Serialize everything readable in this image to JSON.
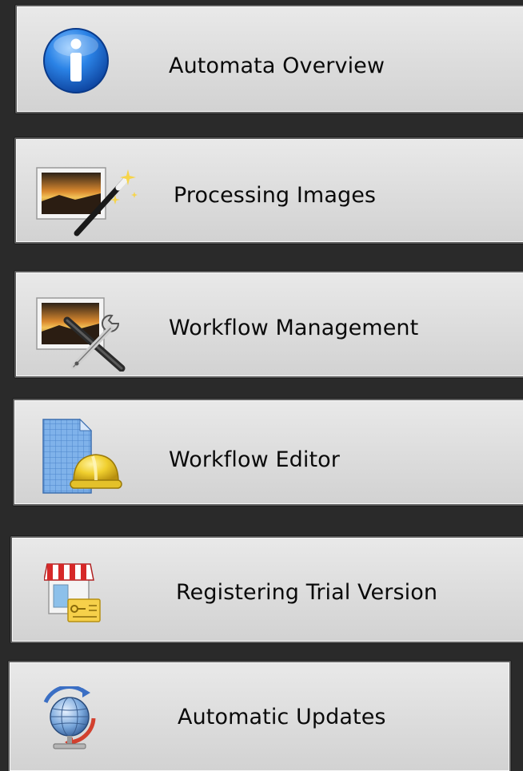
{
  "menu": {
    "items": [
      {
        "label": "Automata Overview",
        "icon": "info-icon"
      },
      {
        "label": "Processing Images",
        "icon": "image-wand-icon"
      },
      {
        "label": "Workflow Management",
        "icon": "image-tools-icon"
      },
      {
        "label": "Workflow Editor",
        "icon": "blueprint-hardhat-icon"
      },
      {
        "label": "Registering Trial Version",
        "icon": "store-license-icon"
      },
      {
        "label": "Automatic Updates",
        "icon": "globe-update-icon"
      }
    ]
  },
  "colors": {
    "background": "#2a2a2a",
    "button_face": "#dfdfdf",
    "button_border": "#5c5c5c",
    "label_text": "#0a0a0a",
    "info_blue": "#1f6fd1"
  }
}
